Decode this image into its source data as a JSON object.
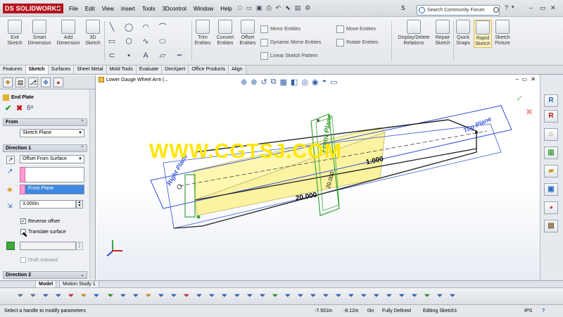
{
  "app": {
    "logo_text": "SOLIDWORKS",
    "logo_mark": "DS",
    "title_partial": "S"
  },
  "menu": [
    "File",
    "Edit",
    "View",
    "Insert",
    "Tools",
    "3Dcontrol",
    "Window",
    "Help"
  ],
  "search": {
    "placeholder": "Search Community Forum"
  },
  "ribbon": {
    "exit_sketch": "Exit Sketch",
    "smart_dimension": "Smart Dimension",
    "add_dimension": "Add Dimension",
    "sketch3d": "3D Sketch",
    "trim": "Trim Entities",
    "convert": "Convert Entities",
    "offset": "Offset Entities",
    "mirror": "Mirror Entities",
    "dyn_mirror": "Dynamic Mirror Entities",
    "linear_pattern": "Linear Sketch Pattern",
    "move": "Move Entities",
    "rotate": "Rotate Entities",
    "display_delete": "Display/Delete Relations",
    "repair": "Repair Sketch",
    "quick_snaps": "Quick Snaps",
    "rapid_sketch": "Rapid Sketch",
    "sketch_picture": "Sketch Picture"
  },
  "cm_tabs": [
    "Features",
    "Sketch",
    "Surfaces",
    "Sheet Metal",
    "Mold Tools",
    "Evaluate",
    "DimXpert",
    "Office Products",
    "Align"
  ],
  "active_tab": "Sketch",
  "feature": {
    "name": "End Plate",
    "from_label": "From",
    "from_value": "Sketch Plane",
    "direction1_label": "Direction 1",
    "end_condition": "Offset From Surface",
    "reference": "Front Plane",
    "depth": "3.000in",
    "reverse_offset": "Reverse offset",
    "translate_surface": "Translate surface",
    "draft_outward": "Draft outward",
    "direction2_label": "Direction 2"
  },
  "viewport": {
    "tree_item": "Lower Gauge Wheel Arm  (...",
    "dim_a": "1.000",
    "dim_b": "20.000",
    "dim_c": "20.000",
    "plane_top": "Top Plane",
    "plane_right": "Right Plane",
    "plane_front": "Front Plane"
  },
  "watermark": "WWW.CGTSJ.COM",
  "bottom_tabs": [
    "Model",
    "Motion Study 1"
  ],
  "status": {
    "message": "Select a handle to modify parameters",
    "x": "-7.931in",
    "y": "-8.12in",
    "z": "0in",
    "state": "Fully Defined",
    "mode": "Editing Sketch1",
    "units": "IPS"
  },
  "colors": {
    "accent": "#2f5fc4",
    "brand": "#b5121b",
    "body_yellow": "#fdf7b0",
    "sketch_blue": "#3452d6"
  }
}
